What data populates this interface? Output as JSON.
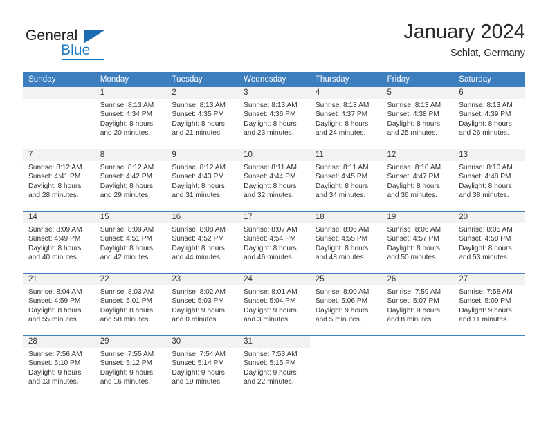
{
  "brand": {
    "name_part1": "General",
    "name_part2": "Blue",
    "triangle_icon": "triangle-icon",
    "accent_color": "#1f7cc4",
    "dark_color": "#231f20"
  },
  "header": {
    "title": "January 2024",
    "subtitle": "Schlat, Germany"
  },
  "theme": {
    "header_blue": "#3d7ebf",
    "daynum_gray": "#f2f2f2"
  },
  "weekdays": [
    "Sunday",
    "Monday",
    "Tuesday",
    "Wednesday",
    "Thursday",
    "Friday",
    "Saturday"
  ],
  "weeks": [
    [
      {
        "day": "",
        "lines": []
      },
      {
        "day": "1",
        "lines": [
          "Sunrise: 8:13 AM",
          "Sunset: 4:34 PM",
          "Daylight: 8 hours",
          "and 20 minutes."
        ]
      },
      {
        "day": "2",
        "lines": [
          "Sunrise: 8:13 AM",
          "Sunset: 4:35 PM",
          "Daylight: 8 hours",
          "and 21 minutes."
        ]
      },
      {
        "day": "3",
        "lines": [
          "Sunrise: 8:13 AM",
          "Sunset: 4:36 PM",
          "Daylight: 8 hours",
          "and 23 minutes."
        ]
      },
      {
        "day": "4",
        "lines": [
          "Sunrise: 8:13 AM",
          "Sunset: 4:37 PM",
          "Daylight: 8 hours",
          "and 24 minutes."
        ]
      },
      {
        "day": "5",
        "lines": [
          "Sunrise: 8:13 AM",
          "Sunset: 4:38 PM",
          "Daylight: 8 hours",
          "and 25 minutes."
        ]
      },
      {
        "day": "6",
        "lines": [
          "Sunrise: 8:13 AM",
          "Sunset: 4:39 PM",
          "Daylight: 8 hours",
          "and 26 minutes."
        ]
      }
    ],
    [
      {
        "day": "7",
        "lines": [
          "Sunrise: 8:12 AM",
          "Sunset: 4:41 PM",
          "Daylight: 8 hours",
          "and 28 minutes."
        ]
      },
      {
        "day": "8",
        "lines": [
          "Sunrise: 8:12 AM",
          "Sunset: 4:42 PM",
          "Daylight: 8 hours",
          "and 29 minutes."
        ]
      },
      {
        "day": "9",
        "lines": [
          "Sunrise: 8:12 AM",
          "Sunset: 4:43 PM",
          "Daylight: 8 hours",
          "and 31 minutes."
        ]
      },
      {
        "day": "10",
        "lines": [
          "Sunrise: 8:11 AM",
          "Sunset: 4:44 PM",
          "Daylight: 8 hours",
          "and 32 minutes."
        ]
      },
      {
        "day": "11",
        "lines": [
          "Sunrise: 8:11 AM",
          "Sunset: 4:45 PM",
          "Daylight: 8 hours",
          "and 34 minutes."
        ]
      },
      {
        "day": "12",
        "lines": [
          "Sunrise: 8:10 AM",
          "Sunset: 4:47 PM",
          "Daylight: 8 hours",
          "and 36 minutes."
        ]
      },
      {
        "day": "13",
        "lines": [
          "Sunrise: 8:10 AM",
          "Sunset: 4:48 PM",
          "Daylight: 8 hours",
          "and 38 minutes."
        ]
      }
    ],
    [
      {
        "day": "14",
        "lines": [
          "Sunrise: 8:09 AM",
          "Sunset: 4:49 PM",
          "Daylight: 8 hours",
          "and 40 minutes."
        ]
      },
      {
        "day": "15",
        "lines": [
          "Sunrise: 8:09 AM",
          "Sunset: 4:51 PM",
          "Daylight: 8 hours",
          "and 42 minutes."
        ]
      },
      {
        "day": "16",
        "lines": [
          "Sunrise: 8:08 AM",
          "Sunset: 4:52 PM",
          "Daylight: 8 hours",
          "and 44 minutes."
        ]
      },
      {
        "day": "17",
        "lines": [
          "Sunrise: 8:07 AM",
          "Sunset: 4:54 PM",
          "Daylight: 8 hours",
          "and 46 minutes."
        ]
      },
      {
        "day": "18",
        "lines": [
          "Sunrise: 8:06 AM",
          "Sunset: 4:55 PM",
          "Daylight: 8 hours",
          "and 48 minutes."
        ]
      },
      {
        "day": "19",
        "lines": [
          "Sunrise: 8:06 AM",
          "Sunset: 4:57 PM",
          "Daylight: 8 hours",
          "and 50 minutes."
        ]
      },
      {
        "day": "20",
        "lines": [
          "Sunrise: 8:05 AM",
          "Sunset: 4:58 PM",
          "Daylight: 8 hours",
          "and 53 minutes."
        ]
      }
    ],
    [
      {
        "day": "21",
        "lines": [
          "Sunrise: 8:04 AM",
          "Sunset: 4:59 PM",
          "Daylight: 8 hours",
          "and 55 minutes."
        ]
      },
      {
        "day": "22",
        "lines": [
          "Sunrise: 8:03 AM",
          "Sunset: 5:01 PM",
          "Daylight: 8 hours",
          "and 58 minutes."
        ]
      },
      {
        "day": "23",
        "lines": [
          "Sunrise: 8:02 AM",
          "Sunset: 5:03 PM",
          "Daylight: 9 hours",
          "and 0 minutes."
        ]
      },
      {
        "day": "24",
        "lines": [
          "Sunrise: 8:01 AM",
          "Sunset: 5:04 PM",
          "Daylight: 9 hours",
          "and 3 minutes."
        ]
      },
      {
        "day": "25",
        "lines": [
          "Sunrise: 8:00 AM",
          "Sunset: 5:06 PM",
          "Daylight: 9 hours",
          "and 5 minutes."
        ]
      },
      {
        "day": "26",
        "lines": [
          "Sunrise: 7:59 AM",
          "Sunset: 5:07 PM",
          "Daylight: 9 hours",
          "and 8 minutes."
        ]
      },
      {
        "day": "27",
        "lines": [
          "Sunrise: 7:58 AM",
          "Sunset: 5:09 PM",
          "Daylight: 9 hours",
          "and 11 minutes."
        ]
      }
    ],
    [
      {
        "day": "28",
        "lines": [
          "Sunrise: 7:56 AM",
          "Sunset: 5:10 PM",
          "Daylight: 9 hours",
          "and 13 minutes."
        ]
      },
      {
        "day": "29",
        "lines": [
          "Sunrise: 7:55 AM",
          "Sunset: 5:12 PM",
          "Daylight: 9 hours",
          "and 16 minutes."
        ]
      },
      {
        "day": "30",
        "lines": [
          "Sunrise: 7:54 AM",
          "Sunset: 5:14 PM",
          "Daylight: 9 hours",
          "and 19 minutes."
        ]
      },
      {
        "day": "31",
        "lines": [
          "Sunrise: 7:53 AM",
          "Sunset: 5:15 PM",
          "Daylight: 9 hours",
          "and 22 minutes."
        ]
      },
      {
        "day": "",
        "lines": []
      },
      {
        "day": "",
        "lines": []
      },
      {
        "day": "",
        "lines": []
      }
    ]
  ]
}
